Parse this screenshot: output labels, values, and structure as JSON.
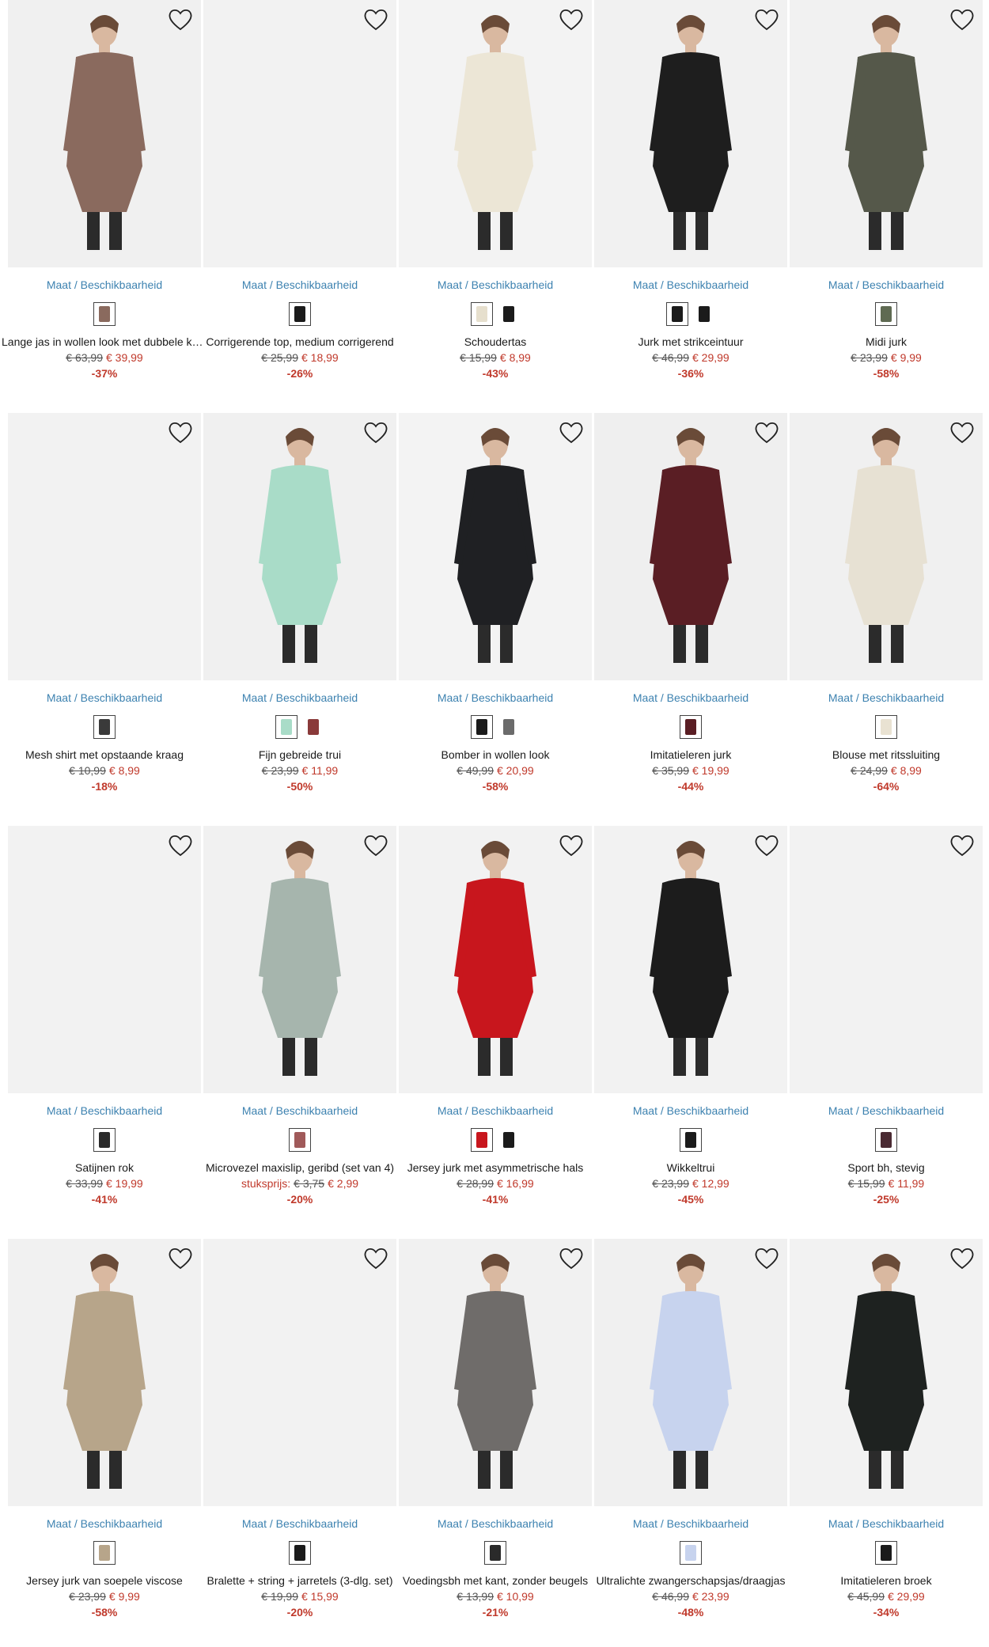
{
  "common": {
    "size_link": "Maat / Beschikbaarheid",
    "unit_label": "stuksprijs:"
  },
  "products": [
    {
      "name": "Lange jas in wollen look met dubbele knopenrij",
      "old": "€ 63,99",
      "new": "€ 39,99",
      "disc": "-37%",
      "swatches": [
        "#8a6a5e"
      ],
      "photo_bg": "#f0f0f0",
      "fig": "#8a6a5e"
    },
    {
      "name": "Corrigerende top, medium corrigerend",
      "old": "€ 25,99",
      "new": "€ 18,99",
      "disc": "-26%",
      "swatches": [
        "#1b1b1b"
      ],
      "photo_bg": "#f2f2f2",
      "fig": ""
    },
    {
      "name": "Schoudertas",
      "old": "€ 15,99",
      "new": "€ 8,99",
      "disc": "-43%",
      "swatches": [
        "#e6dfcd",
        "#1b1b1b"
      ],
      "photo_bg": "#f3f3f3",
      "fig": "#ece6d6"
    },
    {
      "name": "Jurk met strikceintuur",
      "old": "€ 46,99",
      "new": "€ 29,99",
      "disc": "-36%",
      "swatches": [
        "#1b1b1b",
        "#1b1b1b"
      ],
      "photo_bg": "#f1f1f1",
      "fig": "#1e1e1e"
    },
    {
      "name": "Midi jurk",
      "old": "€ 23,99",
      "new": "€ 9,99",
      "disc": "-58%",
      "swatches": [
        "#5f6a52"
      ],
      "photo_bg": "#f1f1f1",
      "fig": "#55584a"
    },
    {
      "name": "Mesh shirt met opstaande kraag",
      "old": "€ 10,99",
      "new": "€ 8,99",
      "disc": "-18%",
      "swatches": [
        "#3a3a3a"
      ],
      "photo_bg": "#f2f2f2",
      "fig": ""
    },
    {
      "name": "Fijn gebreide trui",
      "old": "€ 23,99",
      "new": "€ 11,99",
      "disc": "-50%",
      "swatches": [
        "#a9dcc8",
        "#8a3a3a"
      ],
      "photo_bg": "#f0f0f0",
      "fig": "#a9dcc8"
    },
    {
      "name": "Bomber in wollen look",
      "old": "€ 49,99",
      "new": "€ 20,99",
      "disc": "-58%",
      "swatches": [
        "#1b1b1b",
        "#6b6b6b"
      ],
      "photo_bg": "#f3f3f3",
      "fig": "#1f2023"
    },
    {
      "name": "Imitatieleren jurk",
      "old": "€ 35,99",
      "new": "€ 19,99",
      "disc": "-44%",
      "swatches": [
        "#5a1e24"
      ],
      "photo_bg": "#efefef",
      "fig": "#5a1e24"
    },
    {
      "name": "Blouse met ritssluiting",
      "old": "€ 24,99",
      "new": "€ 8,99",
      "disc": "-64%",
      "swatches": [
        "#e9e2d2"
      ],
      "photo_bg": "#f0f0f0",
      "fig": "#e7e1d3"
    },
    {
      "name": "Satijnen rok",
      "old": "€ 33,99",
      "new": "€ 19,99",
      "disc": "-41%",
      "swatches": [
        "#2a2a2a"
      ],
      "photo_bg": "#f2f2f2",
      "fig": ""
    },
    {
      "name": "Microvezel maxislip, geribd (set van 4)",
      "old": "€ 3,75",
      "new": "€ 2,99",
      "disc": "-20%",
      "unit": true,
      "swatches": [
        "#a05a5a"
      ],
      "photo_bg": "#f1f1f1",
      "fig": "#a6b5ad"
    },
    {
      "name": "Jersey jurk met asymmetrische hals",
      "old": "€ 28,99",
      "new": "€ 16,99",
      "disc": "-41%",
      "swatches": [
        "#c8161d",
        "#1b1b1b"
      ],
      "photo_bg": "#f2f2f2",
      "fig": "#c8161d"
    },
    {
      "name": "Wikkeltrui",
      "old": "€ 23,99",
      "new": "€ 12,99",
      "disc": "-45%",
      "swatches": [
        "#1b1b1b"
      ],
      "photo_bg": "#f2f2f2",
      "fig": "#1c1c1c"
    },
    {
      "name": "Sport bh, stevig",
      "old": "€ 15,99",
      "new": "€ 11,99",
      "disc": "-25%",
      "swatches": [
        "#4a2a32"
      ],
      "photo_bg": "#f2f2f2",
      "fig": ""
    },
    {
      "name": "Jersey jurk van soepele viscose",
      "old": "€ 23,99",
      "new": "€ 9,99",
      "disc": "-58%",
      "swatches": [
        "#b7a58a"
      ],
      "photo_bg": "#f1f1f1",
      "fig": "#b7a58a"
    },
    {
      "name": "Bralette + string + jarretels (3-dlg. set)",
      "old": "€ 19,99",
      "new": "€ 15,99",
      "disc": "-20%",
      "swatches": [
        "#1b1b1b"
      ],
      "photo_bg": "#f2f2f2",
      "fig": ""
    },
    {
      "name": "Voedingsbh met kant, zonder beugels",
      "old": "€ 13,99",
      "new": "€ 10,99",
      "disc": "-21%",
      "swatches": [
        "#2a2a2a"
      ],
      "photo_bg": "#f1f1f1",
      "fig": "#6f6c6a"
    },
    {
      "name": "Ultralichte zwangerschapsjas/draagjas",
      "old": "€ 46,99",
      "new": "€ 23,99",
      "disc": "-48%",
      "swatches": [
        "#c7d3ee"
      ],
      "photo_bg": "#f0f0f0",
      "fig": "#c7d3ee"
    },
    {
      "name": "Imitatieleren broek",
      "old": "€ 45,99",
      "new": "€ 29,99",
      "disc": "-34%",
      "swatches": [
        "#1b1b1b"
      ],
      "photo_bg": "#f2f2f2",
      "fig": "#1e2220"
    }
  ]
}
